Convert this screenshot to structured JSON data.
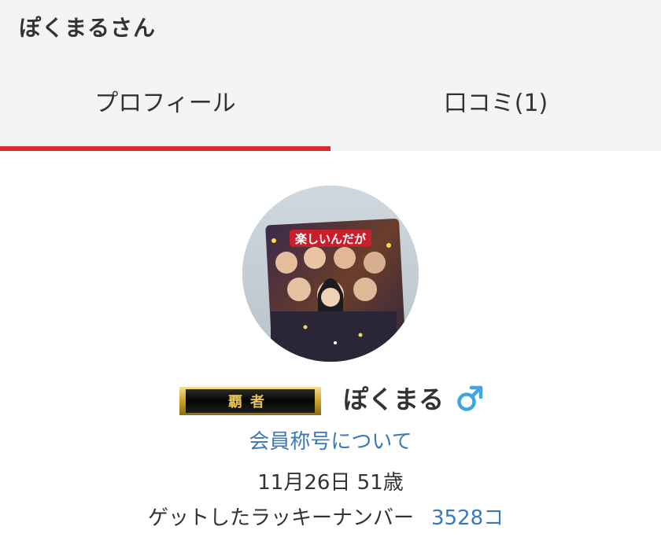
{
  "header": {
    "title": "ぽくまるさん"
  },
  "tabs": [
    {
      "label": "プロフィール",
      "active": true
    },
    {
      "label": "口コミ(1)",
      "active": false
    }
  ],
  "colors": {
    "accent": "#d82b2b",
    "link": "#3a79b8",
    "male": "#3ea6dc"
  },
  "profile": {
    "avatar_caption": "楽しいんだが",
    "rank_badge_text": "覇者",
    "username": "ぽくまる",
    "gender_icon": "male-symbol-icon",
    "gender_glyph": "♂",
    "title_link": "会員称号について",
    "birthday": "11月26日 51歳",
    "lucky_label": "ゲットしたラッキーナンバー",
    "lucky_count": "3528コ"
  }
}
